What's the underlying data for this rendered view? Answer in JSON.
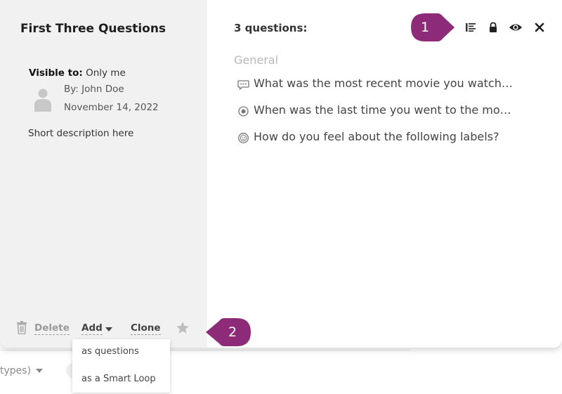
{
  "card": {
    "title": "First Three Questions",
    "visible_label": "Visible to:",
    "visible_value": "Only me",
    "author": "By: John Doe",
    "date": "November 14, 2022",
    "description": "Short description here"
  },
  "actions": {
    "delete": "Delete",
    "add": "Add",
    "clone": "Clone"
  },
  "add_menu": [
    "as questions",
    "as a Smart Loop"
  ],
  "panel": {
    "count": "3 questions:",
    "section": "General",
    "questions": [
      {
        "icon": "speech-bubble-icon",
        "text": "What was the most recent movie you watch…"
      },
      {
        "icon": "radio-button-icon",
        "text": "When was the last time you went to the mo…"
      },
      {
        "icon": "smiley-face-icon",
        "text": "How do you feel about the following labels?"
      }
    ]
  },
  "toolbar_icons": [
    "outline-list-icon",
    "lock-icon",
    "eye-icon",
    "close-icon"
  ],
  "callouts": [
    "1",
    "2"
  ],
  "background": {
    "types_text": "types)"
  },
  "colors": {
    "callout": "#8e2b79",
    "left_panel": "#f1f1f1",
    "section_label": "#b8b8b8"
  }
}
